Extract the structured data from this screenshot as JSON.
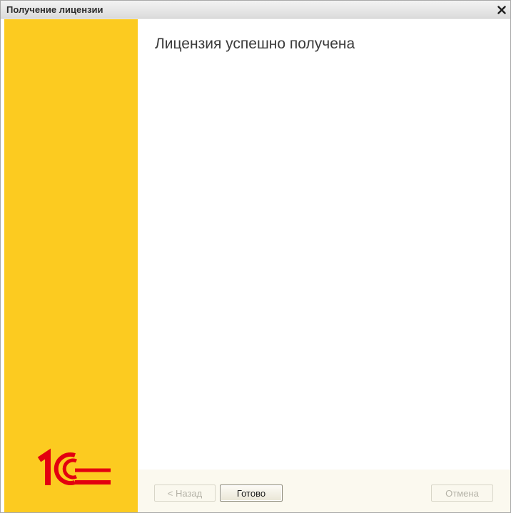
{
  "window": {
    "title": "Получение лицензии",
    "close_icon": "close-icon"
  },
  "main": {
    "heading": "Лицензия успешно получена"
  },
  "sidebar": {
    "background_color": "#fccb20",
    "logo": "1c-logo",
    "logo_color": "#e3000f"
  },
  "footer": {
    "back_label": "< Назад",
    "done_label": "Готово",
    "cancel_label": "Отмена",
    "back_enabled": false,
    "cancel_enabled": false
  }
}
